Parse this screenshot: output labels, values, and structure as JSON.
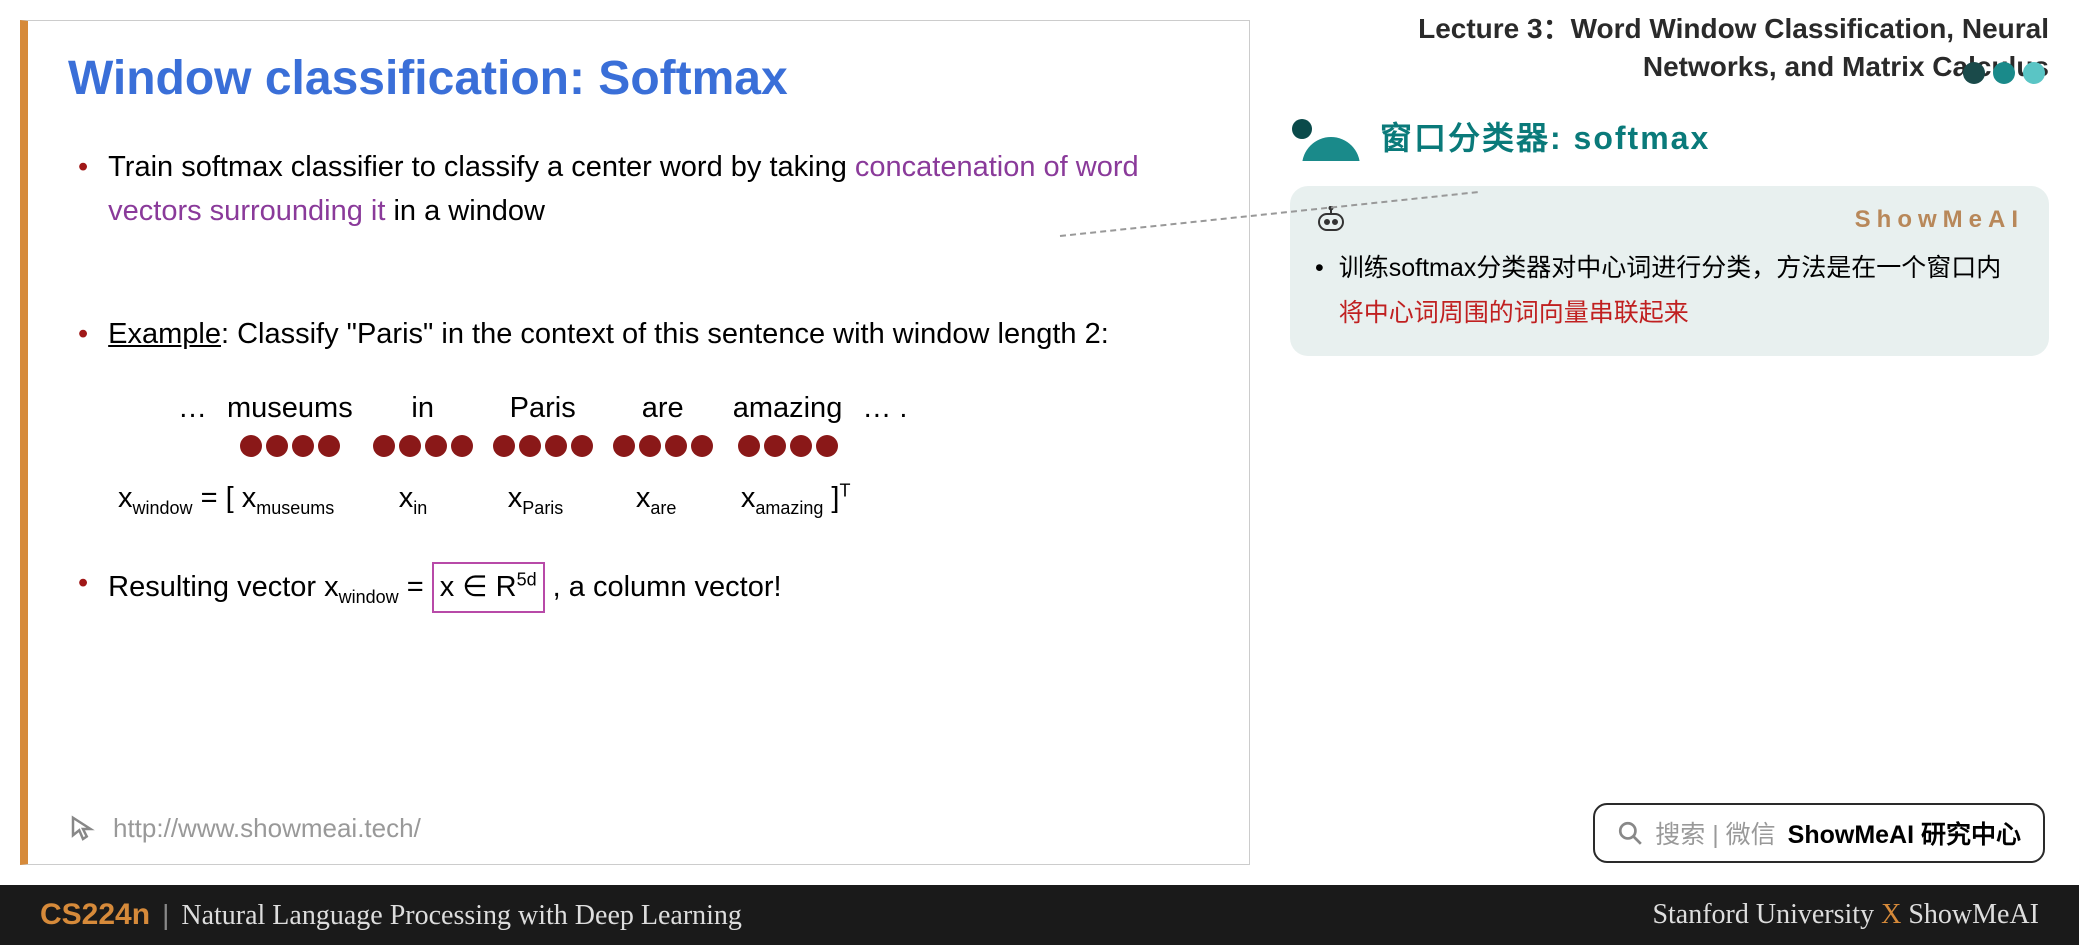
{
  "slide": {
    "title": "Window classification: Softmax",
    "bullet1_a": "Train softmax classifier to classify a center word by taking ",
    "bullet1_b": "concatenation of word vectors surrounding it",
    "bullet1_c": " in a window",
    "bullet2_label": "Example",
    "bullet2_rest": ": Classify \"Paris\" in the context of this sentence with window length 2:",
    "words": {
      "ellipsis_l": "…",
      "w1": "museums",
      "w2": "in",
      "w3": "Paris",
      "w4": "are",
      "w5": "amazing",
      "ellipsis_r": "… ."
    },
    "formula": {
      "x": "x",
      "win": "window",
      "eq": " = [  ",
      "x1": "x",
      "s1": "museums",
      "x2": "x",
      "s2": "in",
      "x3": "x",
      "s3": "Paris",
      "x4": "x",
      "s4": "are",
      "x5": "x",
      "s5": "amazing",
      "close": " ]",
      "T": "T"
    },
    "bullet3_a": "Resulting vector x",
    "bullet3_sub": "window",
    "bullet3_b": " = ",
    "bullet3_box_a": "x ∈ R",
    "bullet3_box_sup": "5d",
    "bullet3_c": "  , a column vector!",
    "footer_url": "http://www.showmeai.tech/"
  },
  "right": {
    "lecture_line1": "Lecture 3：Word Window Classification, Neural",
    "lecture_line2": "Networks, and Matrix Calculus",
    "section_title": "窗口分类器: softmax",
    "showmeai": "ShowMeAI",
    "note_a": "训练softmax分类器对中心词进行分类，方法是在一个窗口内",
    "note_b": "将中心词周围的词向量串联起来"
  },
  "search": {
    "prefix": "搜索 | 微信",
    "bold": "ShowMeAI 研究中心"
  },
  "bottom": {
    "code": "CS224n",
    "pipe": "|",
    "name": "Natural Language Processing with Deep Learning",
    "uni": "Stanford University ",
    "x": "X",
    "brand": " ShowMeAI"
  }
}
